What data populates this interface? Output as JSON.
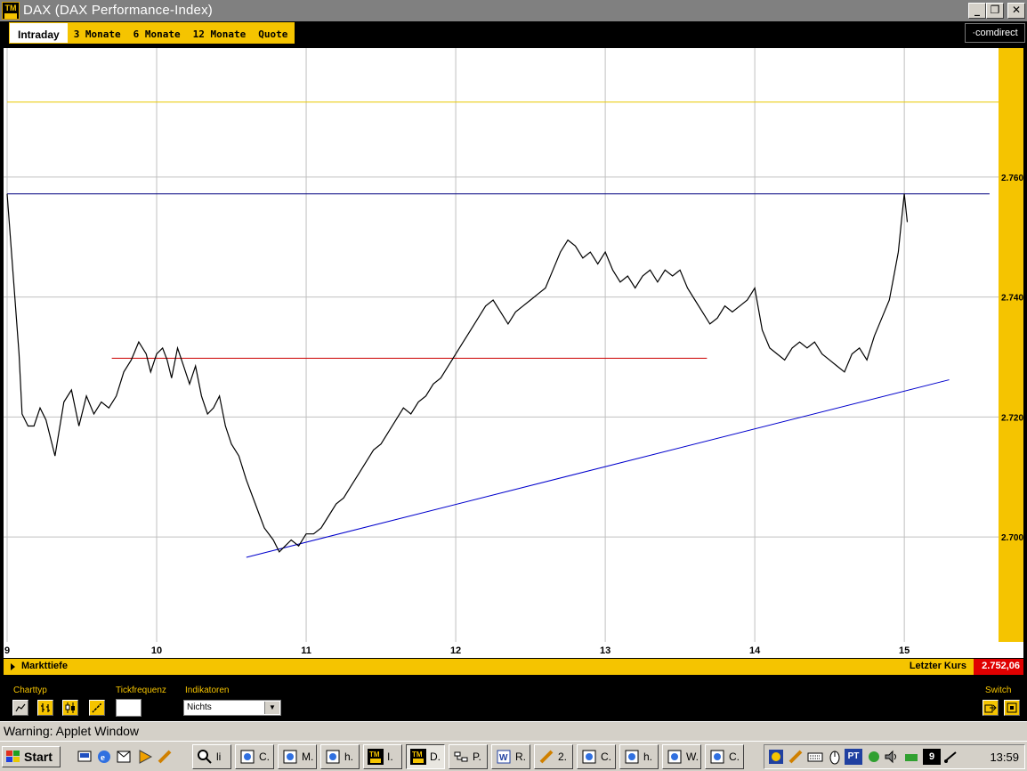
{
  "window": {
    "title": "DAX (DAX Performance-Index)",
    "icon_text": "TM"
  },
  "tabs": [
    "Intraday",
    "3 Monate",
    "6 Monate",
    "12 Monate",
    "Quote"
  ],
  "active_tab": "Intraday",
  "brand": "·comdirect",
  "chart_data": {
    "type": "line",
    "x_ticks": [
      "9",
      "10",
      "11",
      "12",
      "13",
      "14",
      "15"
    ],
    "y_ticks": [
      "2.760",
      "2.740",
      "2.720",
      "2.700"
    ],
    "ylim": [
      2.6825,
      2.7815
    ],
    "xlim": [
      9.0,
      15.63
    ],
    "grid": true,
    "series": [
      {
        "color": "#000000",
        "points": [
          [
            9.0,
            2.7572
          ],
          [
            9.05,
            2.7405
          ],
          [
            9.08,
            2.7305
          ],
          [
            9.1,
            2.7205
          ],
          [
            9.14,
            2.7185
          ],
          [
            9.18,
            2.7185
          ],
          [
            9.22,
            2.7215
          ],
          [
            9.26,
            2.7195
          ],
          [
            9.32,
            2.7135
          ],
          [
            9.38,
            2.7225
          ],
          [
            9.43,
            2.7245
          ],
          [
            9.48,
            2.7185
          ],
          [
            9.53,
            2.7235
          ],
          [
            9.58,
            2.7205
          ],
          [
            9.63,
            2.7225
          ],
          [
            9.68,
            2.7215
          ],
          [
            9.73,
            2.7235
          ],
          [
            9.78,
            2.7275
          ],
          [
            9.83,
            2.7295
          ],
          [
            9.88,
            2.7325
          ],
          [
            9.93,
            2.7305
          ],
          [
            9.96,
            2.7275
          ],
          [
            10.0,
            2.7305
          ],
          [
            10.04,
            2.7315
          ],
          [
            10.07,
            2.7295
          ],
          [
            10.1,
            2.7265
          ],
          [
            10.14,
            2.7315
          ],
          [
            10.18,
            2.7285
          ],
          [
            10.22,
            2.7255
          ],
          [
            10.26,
            2.7285
          ],
          [
            10.3,
            2.7235
          ],
          [
            10.34,
            2.7205
          ],
          [
            10.38,
            2.7215
          ],
          [
            10.42,
            2.7235
          ],
          [
            10.46,
            2.7185
          ],
          [
            10.5,
            2.7155
          ],
          [
            10.55,
            2.7135
          ],
          [
            10.6,
            2.7095
          ],
          [
            10.66,
            2.7055
          ],
          [
            10.72,
            2.7015
          ],
          [
            10.78,
            2.6995
          ],
          [
            10.82,
            2.6975
          ],
          [
            10.86,
            2.6985
          ],
          [
            10.9,
            2.6995
          ],
          [
            10.95,
            2.6985
          ],
          [
            11.0,
            2.7005
          ],
          [
            11.05,
            2.7005
          ],
          [
            11.1,
            2.7015
          ],
          [
            11.15,
            2.7035
          ],
          [
            11.2,
            2.7055
          ],
          [
            11.25,
            2.7065
          ],
          [
            11.3,
            2.7085
          ],
          [
            11.35,
            2.7105
          ],
          [
            11.4,
            2.7125
          ],
          [
            11.45,
            2.7145
          ],
          [
            11.5,
            2.7155
          ],
          [
            11.55,
            2.7175
          ],
          [
            11.6,
            2.7195
          ],
          [
            11.65,
            2.7215
          ],
          [
            11.7,
            2.7205
          ],
          [
            11.75,
            2.7225
          ],
          [
            11.8,
            2.7235
          ],
          [
            11.85,
            2.7255
          ],
          [
            11.9,
            2.7265
          ],
          [
            11.95,
            2.7285
          ],
          [
            12.0,
            2.7305
          ],
          [
            12.05,
            2.7325
          ],
          [
            12.1,
            2.7345
          ],
          [
            12.15,
            2.7365
          ],
          [
            12.2,
            2.7385
          ],
          [
            12.25,
            2.7395
          ],
          [
            12.3,
            2.7375
          ],
          [
            12.35,
            2.7355
          ],
          [
            12.4,
            2.7375
          ],
          [
            12.45,
            2.7385
          ],
          [
            12.5,
            2.7395
          ],
          [
            12.55,
            2.7405
          ],
          [
            12.6,
            2.7415
          ],
          [
            12.65,
            2.7445
          ],
          [
            12.7,
            2.7475
          ],
          [
            12.75,
            2.7495
          ],
          [
            12.8,
            2.7485
          ],
          [
            12.85,
            2.7465
          ],
          [
            12.9,
            2.7475
          ],
          [
            12.95,
            2.7455
          ],
          [
            13.0,
            2.7475
          ],
          [
            13.05,
            2.7445
          ],
          [
            13.1,
            2.7425
          ],
          [
            13.15,
            2.7435
          ],
          [
            13.2,
            2.7415
          ],
          [
            13.25,
            2.7435
          ],
          [
            13.3,
            2.7445
          ],
          [
            13.35,
            2.7425
          ],
          [
            13.4,
            2.7445
          ],
          [
            13.45,
            2.7435
          ],
          [
            13.5,
            2.7445
          ],
          [
            13.55,
            2.7415
          ],
          [
            13.6,
            2.7395
          ],
          [
            13.65,
            2.7375
          ],
          [
            13.7,
            2.7355
          ],
          [
            13.75,
            2.7365
          ],
          [
            13.8,
            2.7385
          ],
          [
            13.85,
            2.7375
          ],
          [
            13.9,
            2.7385
          ],
          [
            13.95,
            2.7395
          ],
          [
            14.0,
            2.7415
          ],
          [
            14.05,
            2.7345
          ],
          [
            14.1,
            2.7315
          ],
          [
            14.15,
            2.7305
          ],
          [
            14.2,
            2.7295
          ],
          [
            14.25,
            2.7315
          ],
          [
            14.3,
            2.7325
          ],
          [
            14.35,
            2.7315
          ],
          [
            14.4,
            2.7325
          ],
          [
            14.45,
            2.7305
          ],
          [
            14.5,
            2.7295
          ],
          [
            14.55,
            2.7285
          ],
          [
            14.6,
            2.7275
          ],
          [
            14.65,
            2.7305
          ],
          [
            14.7,
            2.7315
          ],
          [
            14.75,
            2.7295
          ],
          [
            14.8,
            2.7335
          ],
          [
            14.85,
            2.7365
          ],
          [
            14.9,
            2.7395
          ],
          [
            14.93,
            2.7435
          ],
          [
            14.96,
            2.7475
          ],
          [
            14.98,
            2.7525
          ],
          [
            15.0,
            2.7572
          ],
          [
            15.02,
            2.7525
          ]
        ]
      }
    ],
    "overlays": [
      {
        "kind": "hline",
        "color": "#e8c800",
        "y": 2.7725,
        "x_from": 9.0,
        "x_to": 15.63
      },
      {
        "kind": "hline",
        "color": "#000080",
        "y": 2.7572,
        "x_from": 9.0,
        "x_to": 15.57
      },
      {
        "kind": "hline",
        "color": "#cc0000",
        "y": 2.7298,
        "x_from": 9.7,
        "x_to": 13.68
      },
      {
        "kind": "segment",
        "color": "#0000cc",
        "x1": 10.6,
        "y1": 2.6966,
        "x2": 15.3,
        "y2": 2.7262
      }
    ]
  },
  "depth": {
    "label": "Markttiefe",
    "last_label": "Letzter Kurs",
    "last_value": "2.752,06"
  },
  "controls": {
    "chart_type_label": "Charttyp",
    "tick_label": "Tickfrequenz",
    "indicators_label": "Indikatoren",
    "indicator_value": "Nichts",
    "switch_label": "Switch"
  },
  "warning": "Warning: Applet Window",
  "taskbar": {
    "start_label": "Start",
    "tasks": [
      "li",
      "C.",
      "M.",
      "h.",
      "I.",
      "D.",
      "P.",
      "R.",
      "2.",
      "C.",
      "h.",
      "W.",
      "C."
    ],
    "clock": "13:59",
    "tray_text": "PT",
    "calendar_day": "9"
  },
  "colors": {
    "accent": "#f5c400",
    "chart_bg": "#ffffff",
    "axis_bg": "#f5c400",
    "last_value_bg": "#e00000"
  }
}
